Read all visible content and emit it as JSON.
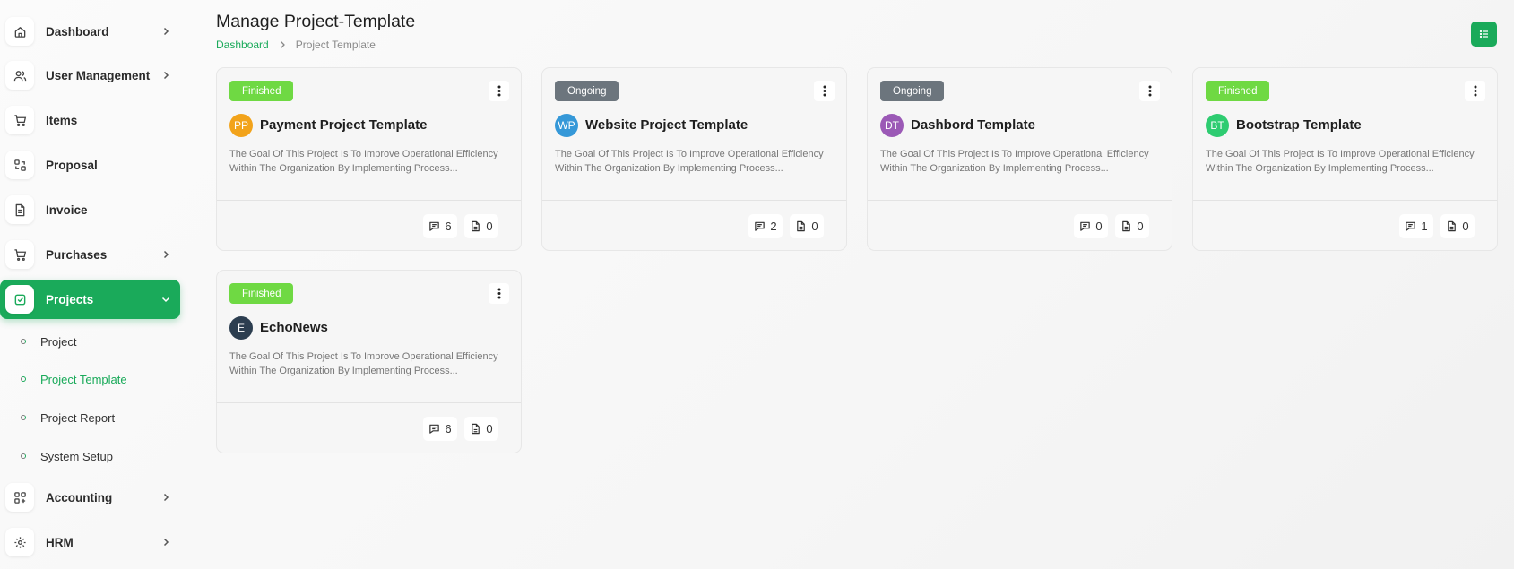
{
  "sidebar": {
    "items": [
      {
        "label": "Dashboard",
        "icon": "home-icon"
      },
      {
        "label": "User Management",
        "icon": "users-icon"
      },
      {
        "label": "Items",
        "icon": "cart-icon"
      },
      {
        "label": "Proposal",
        "icon": "proposal-icon"
      },
      {
        "label": "Invoice",
        "icon": "file-icon"
      },
      {
        "label": "Purchases",
        "icon": "cart-icon"
      },
      {
        "label": "Projects",
        "icon": "check-square-icon"
      },
      {
        "label": "Accounting",
        "icon": "apps-icon"
      },
      {
        "label": "HRM",
        "icon": "hrm-icon"
      }
    ],
    "projects_sub": [
      {
        "label": "Project"
      },
      {
        "label": "Project Template"
      },
      {
        "label": "Project Report"
      },
      {
        "label": "System Setup"
      }
    ]
  },
  "header": {
    "title": "Manage Project-Template",
    "breadcrumb": {
      "home": "Dashboard",
      "current": "Project Template"
    }
  },
  "colors": {
    "accent": "#1aaa5a",
    "finished": "#6fd943",
    "ongoing": "#6c757d"
  },
  "cards": [
    {
      "status": "Finished",
      "initials": "PP",
      "avatar_color": "#f2a31b",
      "title": "Payment Project Template",
      "description": "The Goal Of This Project Is To Improve Operational Efficiency Within The Organization By Implementing Process...",
      "comments": "6",
      "files": "0"
    },
    {
      "status": "Ongoing",
      "initials": "WP",
      "avatar_color": "#3598d8",
      "title": "Website Project Template",
      "description": "The Goal Of This Project Is To Improve Operational Efficiency Within The Organization By Implementing Process...",
      "comments": "2",
      "files": "0"
    },
    {
      "status": "Ongoing",
      "initials": "DT",
      "avatar_color": "#9b59b6",
      "title": "Dashbord Template",
      "description": "The Goal Of This Project Is To Improve Operational Efficiency Within The Organization By Implementing Process...",
      "comments": "0",
      "files": "0"
    },
    {
      "status": "Finished",
      "initials": "BT",
      "avatar_color": "#2ecc71",
      "title": "Bootstrap Template",
      "description": "The Goal Of This Project Is To Improve Operational Efficiency Within The Organization By Implementing Process...",
      "comments": "1",
      "files": "0"
    },
    {
      "status": "Finished",
      "initials": "E",
      "avatar_color": "#2c3e50",
      "title": "EchoNews",
      "description": "The Goal Of This Project Is To Improve Operational Efficiency Within The Organization By Implementing Process...",
      "comments": "6",
      "files": "0"
    }
  ]
}
